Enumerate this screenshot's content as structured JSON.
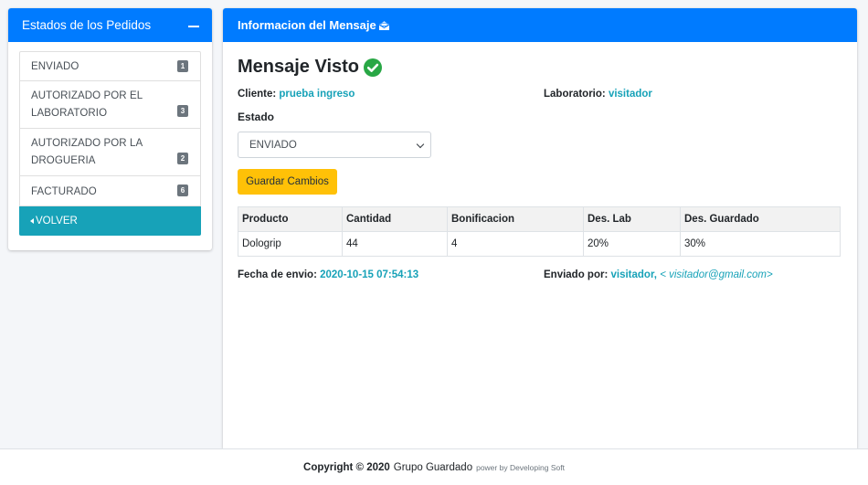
{
  "sidebar": {
    "title": "Estados de los Pedidos",
    "items": [
      {
        "label": "ENVIADO",
        "count": "1"
      },
      {
        "label": "AUTORIZADO POR EL LABORATORIO",
        "count": "3"
      },
      {
        "label": "AUTORIZADO POR LA DROGUERIA",
        "count": "2"
      },
      {
        "label": "FACTURADO",
        "count": "6"
      }
    ],
    "back_label": "VOLVER"
  },
  "main": {
    "header_title": "Informacion del Mensaje",
    "message_title": "Mensaje Visto",
    "client_label": "Cliente:",
    "client_value": "prueba ingreso",
    "lab_label": "Laboratorio:",
    "lab_value": "visitador",
    "estado_label": "Estado",
    "estado_selected": "ENVIADO",
    "save_button": "Guardar Cambios",
    "table": {
      "headers": [
        "Producto",
        "Cantidad",
        "Bonificacion",
        "Des. Lab",
        "Des. Guardado"
      ],
      "rows": [
        [
          "Dologrip",
          "44",
          "4",
          "20%",
          "30%"
        ]
      ]
    },
    "sent_date_label": "Fecha de envio:",
    "sent_date_value": "2020-10-15 07:54:13",
    "sent_by_label": "Enviado por:",
    "sent_by_name": "visitador,",
    "sent_by_email": "< visitador@gmail.com>"
  },
  "footer": {
    "copyright": "Copyright © 2020",
    "company": "Grupo Guardado",
    "powered": "power by Developing Soft"
  },
  "colors": {
    "primary": "#007bff",
    "info": "#17a2b8",
    "warning": "#ffc107",
    "badge": "#6c757d",
    "success": "#28a745"
  },
  "icons": {
    "collapse": "minus-icon",
    "back": "caret-left-icon",
    "header": "envelope-open-icon",
    "seen": "check-circle-icon",
    "select": "chevron-down-icon"
  }
}
